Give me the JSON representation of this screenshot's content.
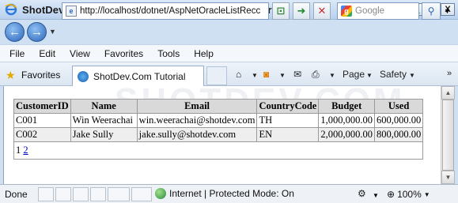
{
  "window": {
    "title": "ShotDev.Com Tutorial - Windows Internet Explorer",
    "btn_minimize": "_",
    "btn_maximize": "□",
    "btn_close": "X"
  },
  "toolbar": {
    "address": "http://localhost/dotnet/AspNetOracleListRecc",
    "search_placeholder": "Google"
  },
  "menu": {
    "items": [
      "File",
      "Edit",
      "View",
      "Favorites",
      "Tools",
      "Help"
    ]
  },
  "favbar": {
    "favorites_label": "Favorites",
    "tab_title": "ShotDev.Com Tutorial",
    "page_label": "Page",
    "safety_label": "Safety"
  },
  "content": {
    "watermark": "SHOTDEV.COM",
    "table": {
      "headers": [
        "CustomerID",
        "Name",
        "Email",
        "CountryCode",
        "Budget",
        "Used"
      ],
      "rows": [
        [
          "C001",
          "Win Weerachai",
          "win.weerachai@shotdev.com",
          "TH",
          "1,000,000.00",
          "600,000.00"
        ],
        [
          "C002",
          "Jake Sully",
          "jake.sully@shotdev.com",
          "EN",
          "2,000,000.00",
          "800,000.00"
        ]
      ],
      "pager": {
        "current": "1",
        "link": "2"
      }
    }
  },
  "status": {
    "text": "Done",
    "zone": "Internet | Protected Mode: On",
    "zoom": "100%"
  }
}
